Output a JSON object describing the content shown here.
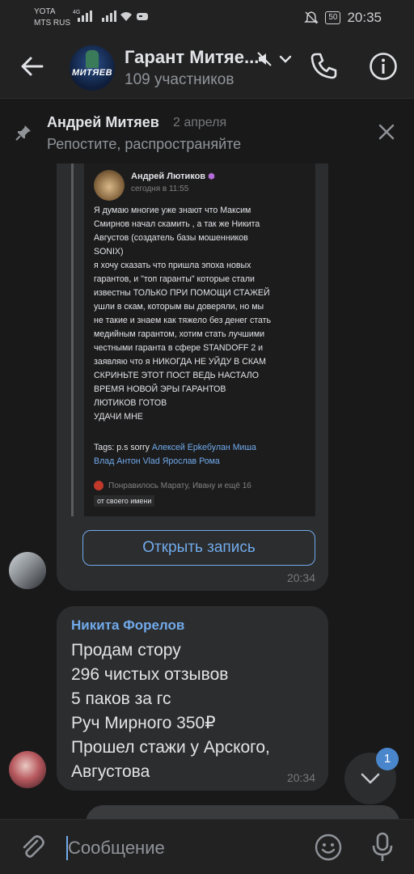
{
  "status_bar": {
    "carrier_line1": "YOTA",
    "carrier_line2": "MTS RUS",
    "net_type": "4G",
    "battery": "50",
    "time": "20:35"
  },
  "header": {
    "title": "Гарант Митяе...",
    "subtitle": "109 участников",
    "avatar_logo_text": "МИТЯЕВ"
  },
  "pinned": {
    "author": "Андрей Митяев",
    "date": "2 апреля",
    "text": "Репостите, распространяйте"
  },
  "messages": [
    {
      "type": "repost",
      "screenshot": {
        "author": "Андрей Лютиков",
        "time": "сегодня в 11:55",
        "body": "Я думаю многие уже знают что Максим\nСмирнов начал скамить , а так же Никита\nАвгустов (создатель базы мошенников\nSONIX)\nя хочу сказать что пришла эпоха новых\nгарантов, и \"топ гаранты\" которые стали\nизвестны ТОЛЬКО ПРИ ПОМОЩИ СТАЖЕЙ\nушли в скам, которым вы доверяли, но мы\nне такие и знаем как тяжело без денег стать\nмедийным гарантом, хотим стать лучшими\nчестными гаранта в сфере STANDOFF 2 и\nзаявляю что я НИКОГДА НЕ УЙДУ В СКАМ\nСКРИНЬТЕ ЭТОТ ПОСТ ВЕДЬ НАСТАЛО\nВРЕМЯ НОВОЙ ЭРЫ ГАРАНТОВ\nЛЮТИКОВ ГОТОВ\nУДАЧИ МНЕ",
        "tags_prefix": "Tags: p.s sorry",
        "tags_links_line1": "Алексей  Ерkeбулан  Миша",
        "tags_links_line2": "Влад Антон Vlad Ярослав Рома",
        "likes": "Понравилось Марату, Ивану и ещё 16",
        "from_label": "от своего имени"
      },
      "button_label": "Открыть запись",
      "time": "20:34"
    },
    {
      "type": "text",
      "author": "Никита Форелов",
      "lines": [
        "Продам стору",
        "296 чистых отзывов",
        "5 паков за гс",
        "Руч Мирного 350₽",
        "Прошел стажи у Арского,",
        "Августова"
      ],
      "time": "20:34"
    }
  ],
  "scroll_badge": "1",
  "composer": {
    "placeholder": "Сообщение"
  },
  "colors": {
    "accent": "#71aaeb",
    "background": "#19191a",
    "bubble": "#2c2d2e",
    "badge": "#4986cc"
  }
}
